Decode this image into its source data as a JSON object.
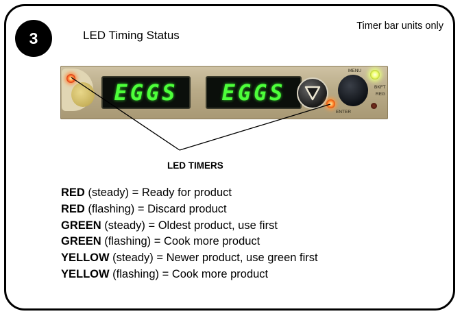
{
  "header": {
    "step_number": "3",
    "title": "LED Timing Status",
    "note": "Timer bar units only"
  },
  "device": {
    "display_left_text": "EGGS",
    "display_right_text": "EGGS",
    "menu_label": "MENU",
    "enter_label": "ENTER",
    "bkft_label": "BKFT",
    "reg_label": "REG"
  },
  "callout": {
    "label": "LED TIMERS"
  },
  "legend": [
    {
      "color": "RED",
      "mode": " (steady) = ",
      "meaning": "Ready for product"
    },
    {
      "color": "RED",
      "mode": " (flashing) = ",
      "meaning": "Discard product"
    },
    {
      "color": "GREEN",
      "mode": " (steady) = ",
      "meaning": "Oldest product, use first"
    },
    {
      "color": "GREEN",
      "mode": " (flashing) = ",
      "meaning": "Cook more product"
    },
    {
      "color": "YELLOW",
      "mode": " (steady) = ",
      "meaning": "Newer product, use green first"
    },
    {
      "color": "YELLOW",
      "mode": " (flashing) = ",
      "meaning": "Cook more product"
    }
  ],
  "colors": {
    "led_red": "#ff5a1f",
    "led_green_digits": "#4dff3a",
    "led_yellow": "#eaff6a",
    "border": "#000000"
  },
  "icons": {
    "down_arrow": "triangle-down-icon"
  }
}
